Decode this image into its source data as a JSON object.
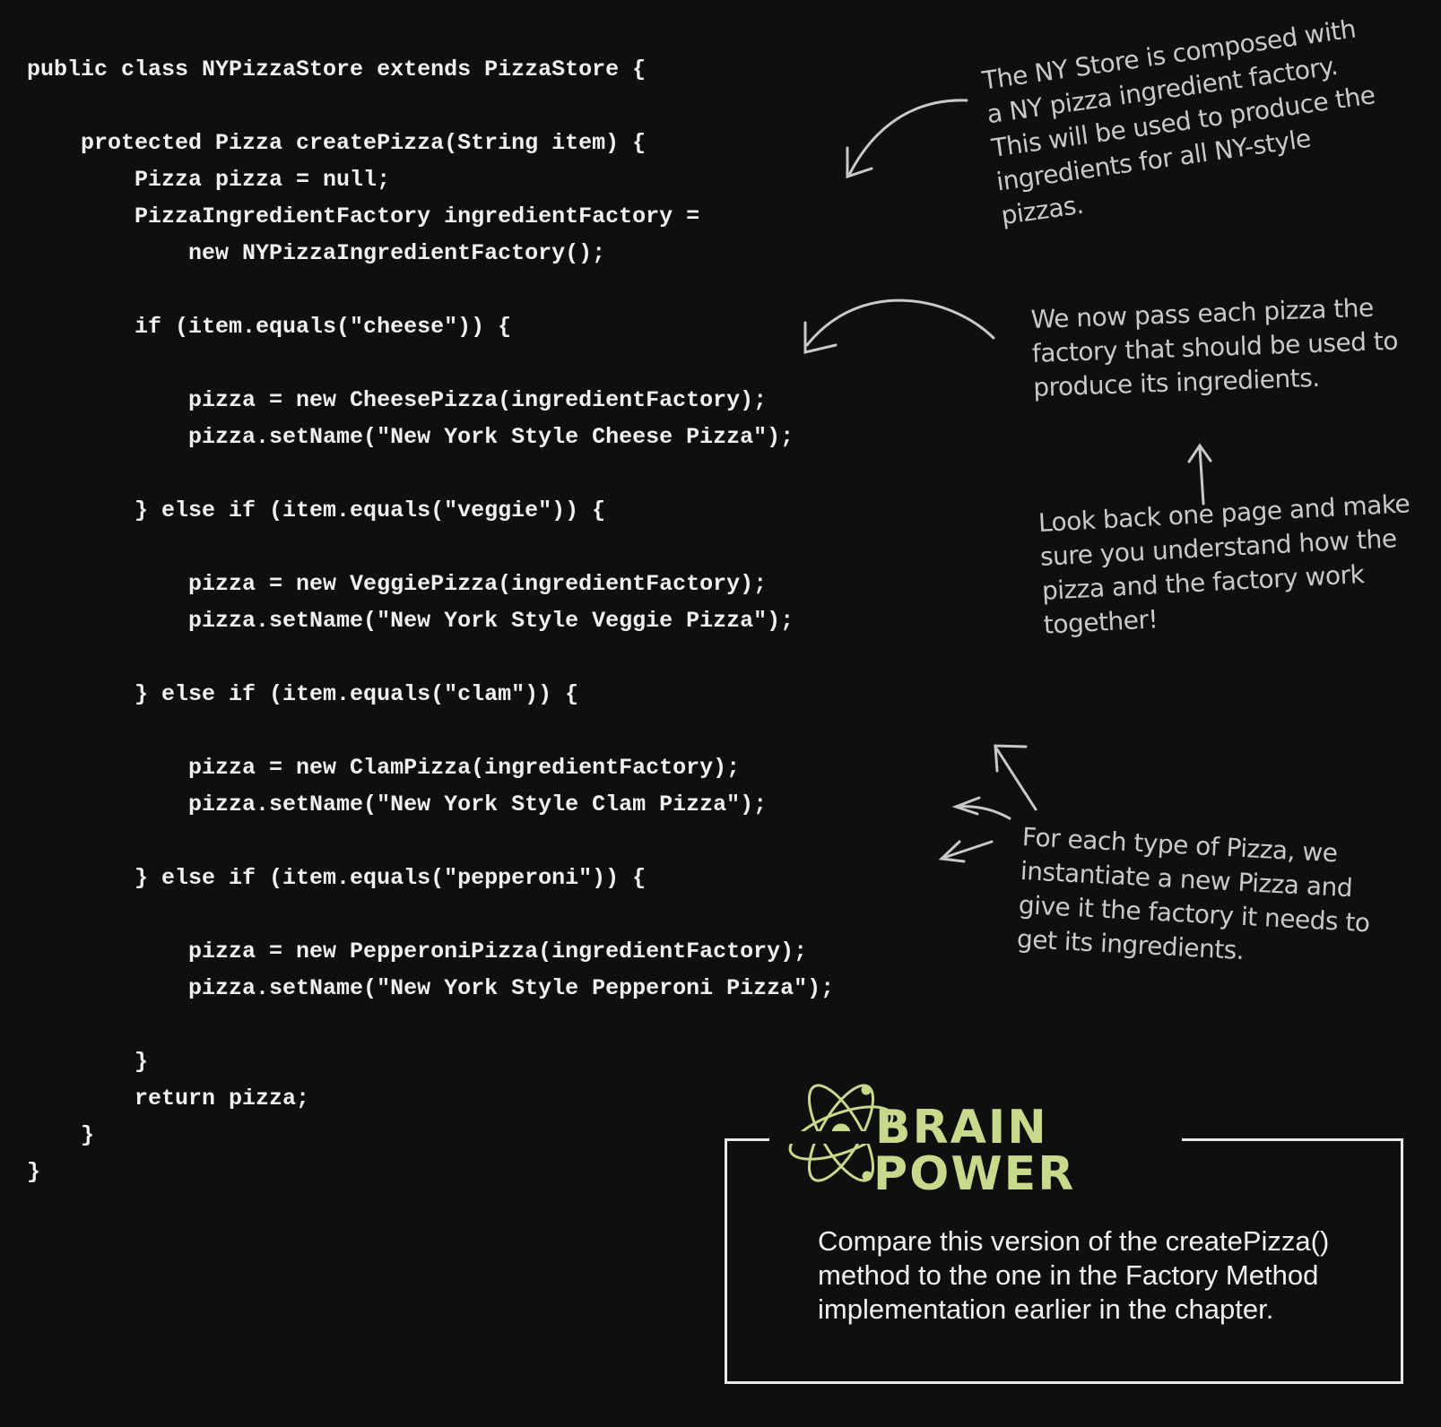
{
  "code": {
    "lines": [
      "public class NYPizzaStore extends PizzaStore {",
      "",
      "    protected Pizza createPizza(String item) {",
      "        Pizza pizza = null;",
      "        PizzaIngredientFactory ingredientFactory =",
      "            new NYPizzaIngredientFactory();",
      "",
      "        if (item.equals(\"cheese\")) {",
      "",
      "            pizza = new CheesePizza(ingredientFactory);",
      "            pizza.setName(\"New York Style Cheese Pizza\");",
      "",
      "        } else if (item.equals(\"veggie\")) {",
      "",
      "            pizza = new VeggiePizza(ingredientFactory);",
      "            pizza.setName(\"New York Style Veggie Pizza\");",
      "",
      "        } else if (item.equals(\"clam\")) {",
      "",
      "            pizza = new ClamPizza(ingredientFactory);",
      "            pizza.setName(\"New York Style Clam Pizza\");",
      "",
      "        } else if (item.equals(\"pepperoni\")) {",
      "",
      "            pizza = new PepperoniPizza(ingredientFactory);",
      "            pizza.setName(\"New York Style Pepperoni Pizza\");",
      "",
      "        }",
      "        return pizza;",
      "    }",
      "}"
    ]
  },
  "annotations": {
    "composed": [
      "The NY Store is composed with",
      "a NY pizza ingredient factory.",
      "This will be used to produce the",
      "ingredients for all NY-style",
      "pizzas."
    ],
    "pass_factory": [
      "We now pass each pizza the",
      "factory that should be used to",
      "produce its ingredients."
    ],
    "look_back": [
      "Look back one page and make",
      "sure you understand how the",
      "pizza and the factory work",
      "together!"
    ],
    "each_type": [
      "For each type of Pizza, we",
      "instantiate a new Pizza and",
      "give it the factory it needs to",
      "get its ingredients."
    ]
  },
  "brain_power": {
    "title_line1": "BRAIN",
    "title_line2": "POWER",
    "body": [
      "Compare this version of the createPizza()",
      "method to the one in the Factory Method",
      "implementation earlier in the chapter."
    ],
    "accent_color": "#c7d98a"
  }
}
